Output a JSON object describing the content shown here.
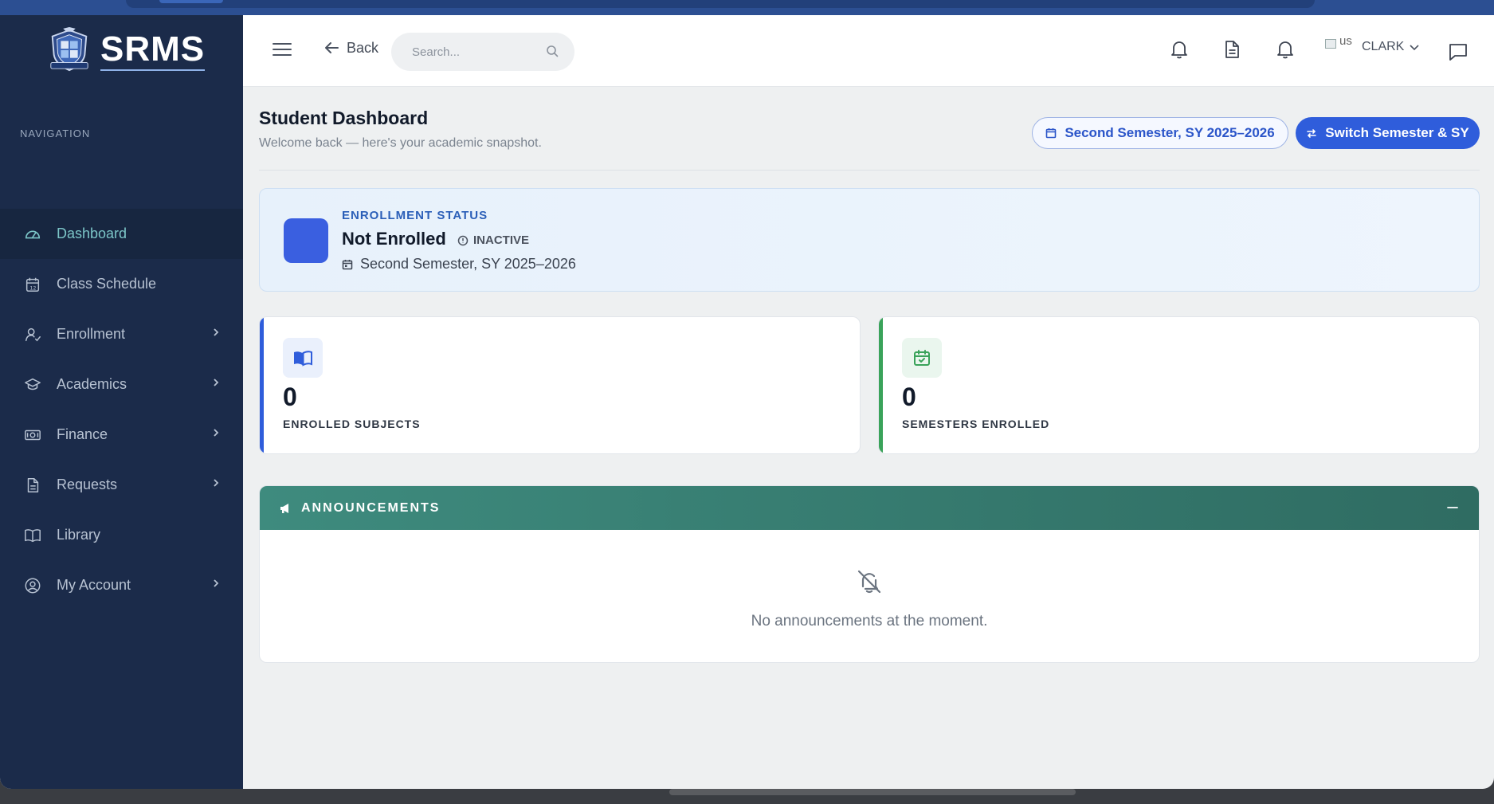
{
  "brand": {
    "name": "SRMS"
  },
  "sidebar": {
    "section_label": "NAVIGATION",
    "items": [
      {
        "label": "Dashboard",
        "icon": "gauge-icon",
        "active": true,
        "has_children": false
      },
      {
        "label": "Class Schedule",
        "icon": "calendar-icon",
        "active": false,
        "has_children": false
      },
      {
        "label": "Enrollment",
        "icon": "user-check-icon",
        "active": false,
        "has_children": true
      },
      {
        "label": "Academics",
        "icon": "graduation-cap-icon",
        "active": false,
        "has_children": true
      },
      {
        "label": "Finance",
        "icon": "cash-icon",
        "active": false,
        "has_children": true
      },
      {
        "label": "Requests",
        "icon": "document-icon",
        "active": false,
        "has_children": true
      },
      {
        "label": "Library",
        "icon": "book-icon",
        "active": false,
        "has_children": false
      },
      {
        "label": "My Account",
        "icon": "user-circle-icon",
        "active": false,
        "has_children": true
      }
    ]
  },
  "topbar": {
    "back_label": "Back",
    "search_placeholder": "Search...",
    "user_avatar_alt": "us",
    "user_name": "CLARK"
  },
  "header": {
    "title": "Student Dashboard",
    "subtitle": "Welcome back — here's your academic snapshot.",
    "semester_badge": "Second Semester, SY 2025–2026",
    "switch_button": "Switch Semester & SY"
  },
  "enrollment": {
    "label": "ENROLLMENT STATUS",
    "status": "Not Enrolled",
    "badge": "INACTIVE",
    "semester": "Second Semester, SY 2025–2026"
  },
  "stats": [
    {
      "value": "0",
      "label": "ENROLLED SUBJECTS",
      "icon": "open-book-icon",
      "color": "#2f5ddb"
    },
    {
      "value": "0",
      "label": "SEMESTERS ENROLLED",
      "icon": "calendar-check-icon",
      "color": "#3aa35a"
    }
  ],
  "announcements": {
    "title": "ANNOUNCEMENTS",
    "empty_text": "No announcements at the moment."
  },
  "colors": {
    "sidebar_bg": "#1b2b4a",
    "primary": "#2f5ddb",
    "announcement_header": "#3e8b7e",
    "active_nav": "#7cc6c8"
  }
}
